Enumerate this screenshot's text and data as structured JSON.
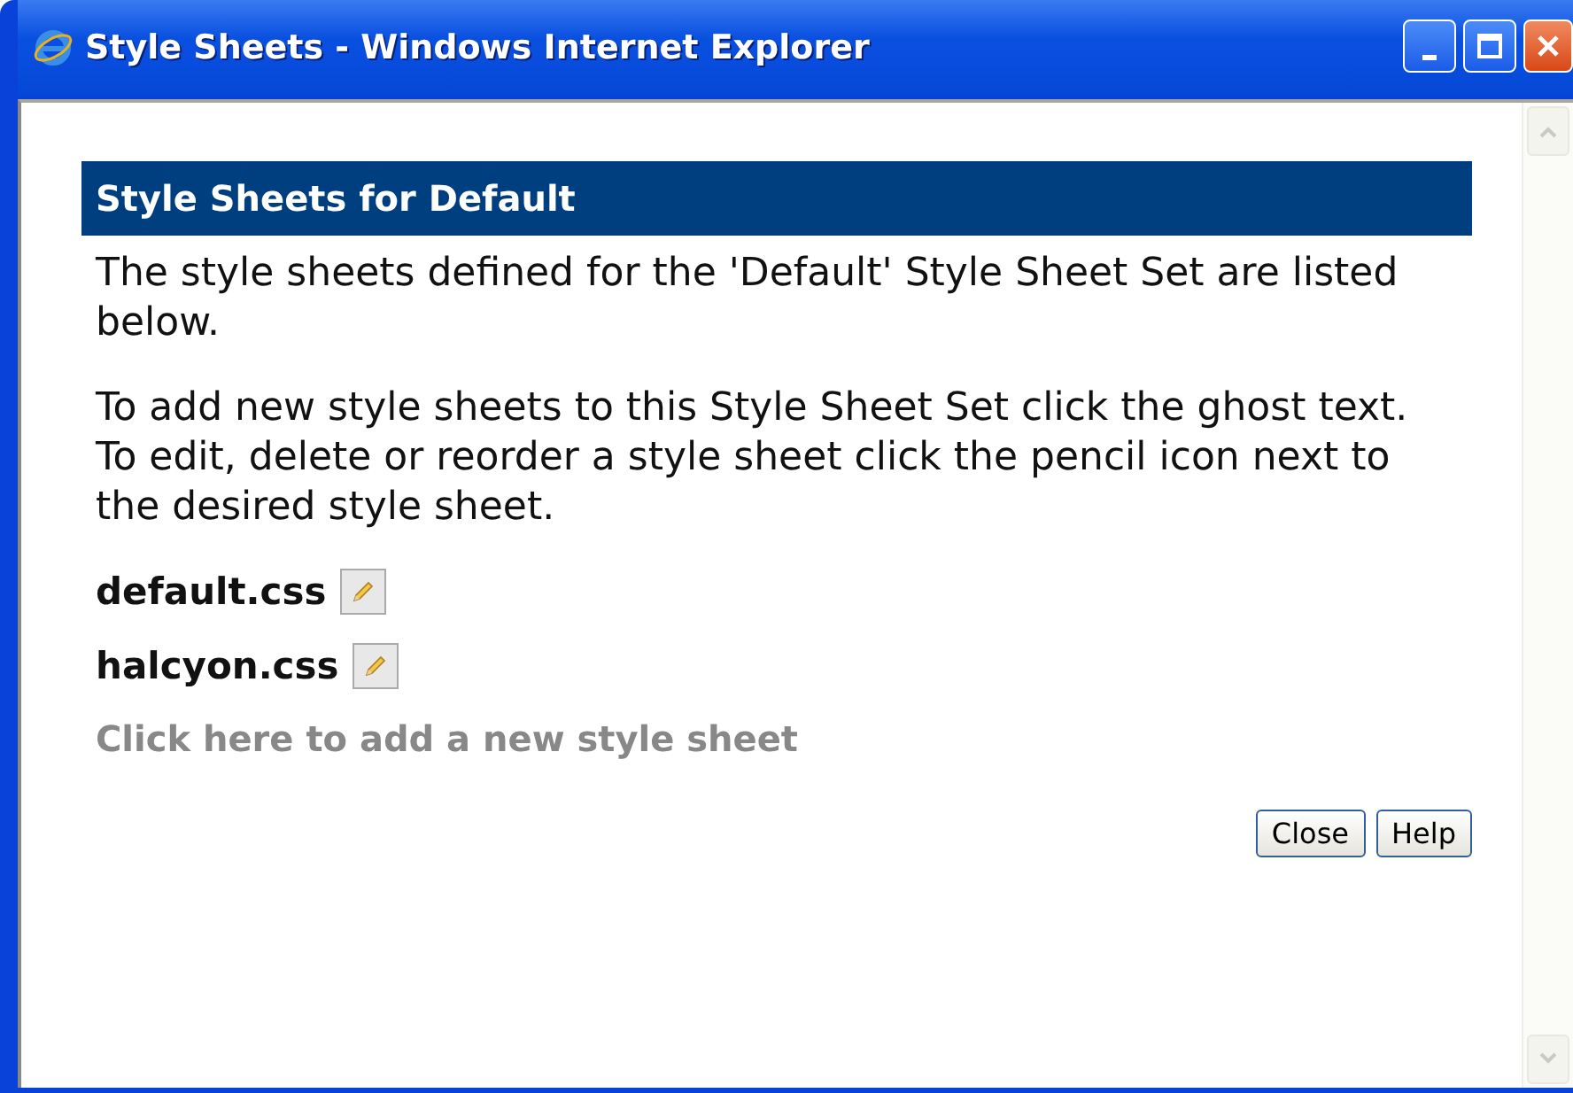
{
  "window": {
    "title": "Style Sheets - Windows Internet Explorer"
  },
  "heading": "Style Sheets for Default",
  "paragraphs": [
    "The style sheets defined for the 'Default' Style Sheet Set are listed below.",
    "To add new style sheets to this Style Sheet Set click the ghost text. To edit, delete or reorder a style sheet click the pencil icon next to the desired style sheet."
  ],
  "style_sheets": [
    {
      "name": "default.css"
    },
    {
      "name": "halcyon.css"
    }
  ],
  "add_link": "Click here to add a new style sheet",
  "buttons": [
    "Close",
    "Help"
  ]
}
